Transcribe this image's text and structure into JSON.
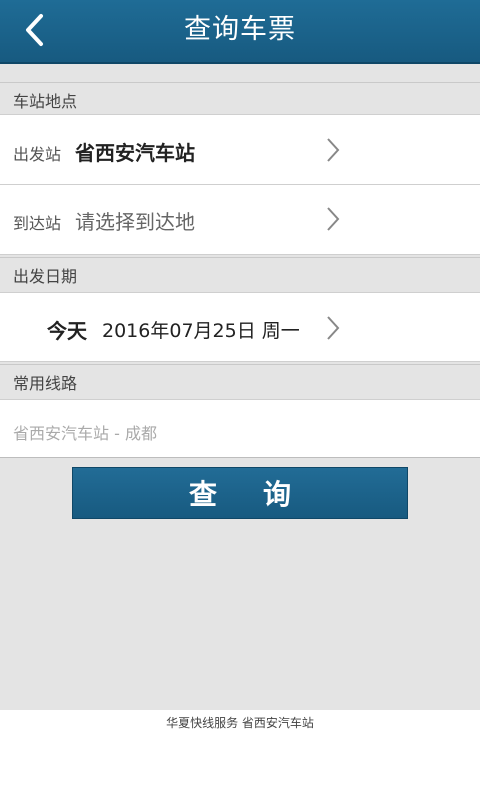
{
  "header": {
    "title": "查询车票",
    "back_icon": "chevron-left-icon"
  },
  "station_section": {
    "title": "车站地点",
    "departure": {
      "label": "出发站",
      "value": "省西安汽车站"
    },
    "arrival": {
      "label": "到达站",
      "value": "请选择到达地"
    }
  },
  "date_section": {
    "title": "出发日期",
    "today_label": "今天",
    "date_value": "2016年07月25日 周一"
  },
  "route_section": {
    "title": "常用线路",
    "routes": [
      "省西安汽车站 - 成都"
    ]
  },
  "query_button": {
    "char1": "查",
    "char2": "询"
  },
  "footer": {
    "text": "华夏快线服务 省西安汽车站"
  },
  "colors": {
    "accent": "#1f6c96",
    "background": "#e4e4e4"
  }
}
